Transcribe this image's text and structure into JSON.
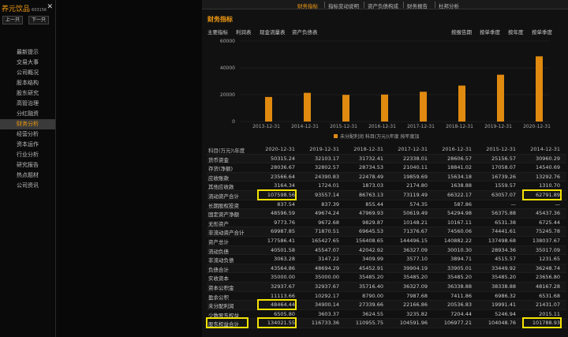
{
  "sidebar": {
    "title": "养元饮品",
    "code": "603156",
    "close": "✕",
    "prev": "上一只",
    "next": "下一只",
    "items": [
      "最新提示",
      "交易大事",
      "公司概况",
      "股本结构",
      "股东研究",
      "高管治理",
      "分红融资",
      "财务分析",
      "经营分析",
      "资本运作",
      "行业分析",
      "研究报告",
      "热点题材",
      "公司资讯"
    ],
    "active_index": 7
  },
  "topnav": {
    "items": [
      "财务指标",
      "指标变动说明",
      "资产负债构成",
      "财务报告",
      "杜邦分析"
    ],
    "active_index": 0
  },
  "section_title": "财务指标",
  "tabs_left": [
    "主要指标",
    "利润表",
    "现金流量表",
    "资产负债表"
  ],
  "tabs_left_active": 3,
  "tabs_right": [
    "按报告期",
    "按单季度",
    "按年度",
    "按单季度"
  ],
  "tabs_right_active": 2,
  "chart_data": {
    "type": "bar",
    "categories": [
      "2013-12-31",
      "2014-12-31",
      "2015-12-31",
      "2016-12-31",
      "2017-12-31",
      "2018-12-31",
      "2019-12-31",
      "2020-12-31"
    ],
    "values": [
      18300,
      21400,
      19900,
      20100,
      22200,
      26800,
      34900,
      48600
    ],
    "ylim": [
      0,
      60000
    ],
    "yticks": [
      "60000",
      "40000",
      "20000",
      "0"
    ],
    "legend": "未分配利润 科目(万元)\\年度 按年度加",
    "bar_color": "#e08a10"
  },
  "table": {
    "columns": [
      "科目(万元)\\年度",
      "2020-12-31",
      "2019-12-31",
      "2018-12-31",
      "2017-12-31",
      "2016-12-31",
      "2015-12-31",
      "2014-12-31"
    ],
    "rows": [
      [
        "货币资金",
        "50315.24",
        "32103.17",
        "31732.41",
        "22338.01",
        "28606.57",
        "25156.57",
        "30960.29"
      ],
      [
        "存货(净额)",
        "28036.67",
        "32802.57",
        "28734.53",
        "21040.11",
        "18841.02",
        "17058.07",
        "14540.69"
      ],
      [
        "应收账款",
        "23566.64",
        "24390.83",
        "22478.49",
        "19859.69",
        "15634.18",
        "16739.26",
        "13292.76"
      ],
      [
        "其他应收款",
        "3164.34",
        "1724.01",
        "1873.03",
        "2174.80",
        "1638.88",
        "1559.57",
        "1310.70"
      ],
      [
        "流动资产合计",
        "107598.56",
        "93557.14",
        "86763.13",
        "73119.49",
        "66322.17",
        "63057.07",
        "62791.89"
      ],
      [
        "长期股权投资",
        "837.54",
        "837.39",
        "855.44",
        "574.35",
        "587.86",
        "—",
        "—"
      ],
      [
        "固定资产净额",
        "48596.59",
        "49674.24",
        "47969.93",
        "50619.49",
        "54294.98",
        "56375.88",
        "45437.36"
      ],
      [
        "无形资产",
        "9773.76",
        "9672.68",
        "9829.87",
        "10148.21",
        "10167.11",
        "6531.38",
        "6725.44"
      ],
      [
        "非流动资产合计",
        "69987.85",
        "71870.51",
        "69645.53",
        "71376.67",
        "74560.06",
        "74441.61",
        "75245.78"
      ],
      [
        "资产总计",
        "177586.41",
        "165427.65",
        "156408.65",
        "144496.15",
        "140882.22",
        "137498.68",
        "138037.67"
      ],
      [
        "流动负债",
        "40501.58",
        "45547.07",
        "42042.92",
        "36327.09",
        "30010.30",
        "28934.36",
        "35017.09"
      ],
      [
        "非流动负债",
        "3063.28",
        "3147.22",
        "3409.99",
        "3577.10",
        "3894.71",
        "4515.57",
        "1231.65"
      ],
      [
        "负债合计",
        "43564.86",
        "48694.29",
        "45452.91",
        "39904.19",
        "33905.01",
        "33449.92",
        "36248.74"
      ],
      [
        "实收资本",
        "35000.00",
        "35000.00",
        "35485.20",
        "35485.20",
        "35485.20",
        "35485.20",
        "23656.80"
      ],
      [
        "资本公积金",
        "32937.67",
        "32937.67",
        "35716.40",
        "36327.09",
        "36338.88",
        "38338.88",
        "48167.28"
      ],
      [
        "盈余公积",
        "11113.66",
        "10292.17",
        "8790.00",
        "7987.68",
        "7411.86",
        "6986.32",
        "6531.68"
      ],
      [
        "未分配利润",
        "48464.44",
        "34900.14",
        "27339.66",
        "22166.86",
        "20536.83",
        "19991.41",
        "21431.07"
      ],
      [
        "少数股东权益",
        "6505.80",
        "3603.37",
        "3624.55",
        "3235.82",
        "7204.44",
        "5246.94",
        "2015.11"
      ],
      [
        "股东权益合计",
        "134021.55",
        "116733.36",
        "110955.75",
        "104591.96",
        "106977.21",
        "104048.76",
        "101788.93"
      ]
    ]
  }
}
